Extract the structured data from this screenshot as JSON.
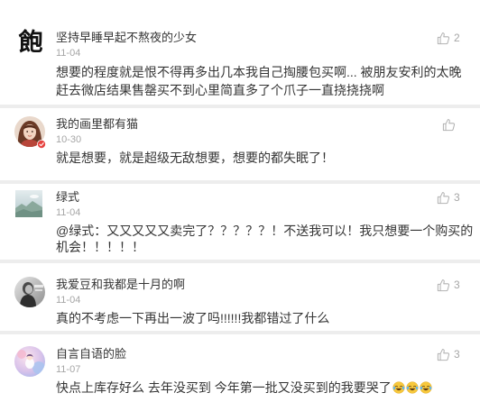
{
  "colors": {
    "name": "#353535",
    "date": "#a6a6a6",
    "text": "#353535",
    "like": "#b2b2b2",
    "background": "#ededed",
    "badge": "#e64340"
  },
  "icons": {
    "like": "thumbs-up-icon",
    "emoji": "laughing-crying-emoji-icon"
  },
  "comments": [
    {
      "avatar": {
        "icon": "calligraphy-avatar",
        "glyph": "飽"
      },
      "name": "坚持早睡早起不熬夜的少女",
      "date": "11-04",
      "likes": "2",
      "text_lines": [
        "想要的程度就是恨不得再多出几本我自己掏腰包买啊... 被朋友安利的太晚",
        "赶去微店结果售罄买不到心里简直多了个爪子一直挠挠挠啊"
      ]
    },
    {
      "avatar": {
        "icon": "girl-photo-avatar",
        "badge": "avatar-badge-icon"
      },
      "name": "我的画里都有猫",
      "date": "10-30",
      "text_lines": [
        "就是想要，就是超级无敌想要，想要的都失眠了！"
      ]
    },
    {
      "avatar": {
        "icon": "landscape-photo-avatar"
      },
      "name": "绿式",
      "date": "11-04",
      "likes": "3",
      "text_lines": [
        "@绿式：又又又又又卖完了？？？？？！不送我可以！我只想要一个购买的",
        "机会！！！！！"
      ]
    },
    {
      "avatar": {
        "icon": "monochrome-photo-avatar"
      },
      "name": "我爱豆和我都是十月的啊",
      "date": "11-04",
      "likes": "3",
      "text_lines": [
        "真的不考虑一下再出一波了吗!!!!!!我都错过了什么"
      ]
    },
    {
      "avatar": {
        "icon": "pastel-illustration-avatar"
      },
      "name": "自言自语的脸",
      "date": "11-07",
      "likes": "3",
      "text_lines": [
        "快点上库存好么 去年没买到 今年第一批又没买到的我要哭了"
      ],
      "emoji": [
        "laughing-crying-face",
        "laughing-crying-face",
        "laughing-crying-face"
      ]
    }
  ]
}
